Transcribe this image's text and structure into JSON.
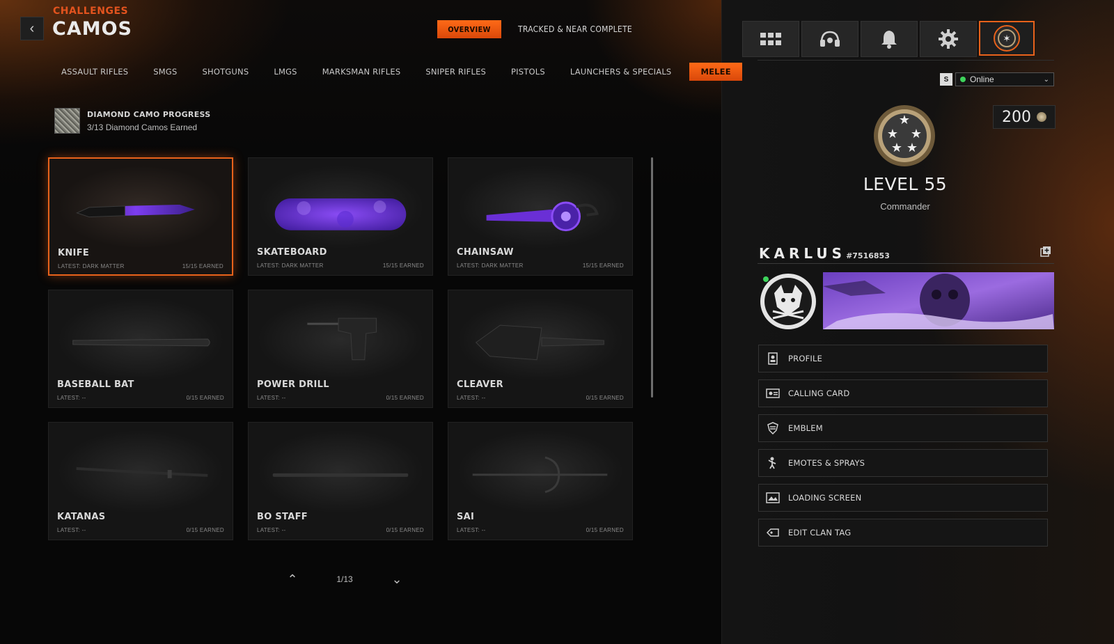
{
  "header": {
    "breadcrumb": "CHALLENGES",
    "title": "CAMOS",
    "tabs": [
      {
        "label": "OVERVIEW",
        "active": true
      },
      {
        "label": "TRACKED & NEAR COMPLETE",
        "active": false
      }
    ]
  },
  "categories": [
    {
      "label": "ASSAULT RIFLES"
    },
    {
      "label": "SMGS"
    },
    {
      "label": "SHOTGUNS"
    },
    {
      "label": "LMGS"
    },
    {
      "label": "MARKSMAN RIFLES"
    },
    {
      "label": "SNIPER RIFLES"
    },
    {
      "label": "PISTOLS"
    },
    {
      "label": "LAUNCHERS & SPECIALS"
    },
    {
      "label": "MELEE",
      "active": true
    }
  ],
  "diamond_progress": {
    "title": "DIAMOND CAMO PROGRESS",
    "subtitle": "3/13 Diamond Camos Earned"
  },
  "weapons": [
    {
      "name": "KNIFE",
      "latest": "LATEST: DARK MATTER",
      "earned": "15/15 EARNED"
    },
    {
      "name": "SKATEBOARD",
      "latest": "LATEST: DARK MATTER",
      "earned": "15/15 EARNED"
    },
    {
      "name": "CHAINSAW",
      "latest": "LATEST: DARK MATTER",
      "earned": "15/15 EARNED"
    },
    {
      "name": "BASEBALL BAT",
      "latest": "LATEST: --",
      "earned": "0/15 EARNED"
    },
    {
      "name": "POWER DRILL",
      "latest": "LATEST: --",
      "earned": "0/15 EARNED"
    },
    {
      "name": "CLEAVER",
      "latest": "LATEST: --",
      "earned": "0/15 EARNED"
    },
    {
      "name": "KATANAS",
      "latest": "LATEST: --",
      "earned": "0/15 EARNED"
    },
    {
      "name": "BO STAFF",
      "latest": "LATEST: --",
      "earned": "0/15 EARNED"
    },
    {
      "name": "SAI",
      "latest": "LATEST: --",
      "earned": "0/15 EARNED"
    }
  ],
  "pager": {
    "label": "1/13"
  },
  "top_icons": [
    "grid-menu-icon",
    "social-headset-icon",
    "notifications-bell-icon",
    "settings-gear-icon",
    "profile-rank-icon"
  ],
  "status": {
    "badge": "S",
    "value": "Online"
  },
  "currency": {
    "value": "200"
  },
  "rank": {
    "level": "LEVEL 55",
    "title": "Commander"
  },
  "player": {
    "name": "KARLUS",
    "tag": "#7516853"
  },
  "menu": [
    {
      "label": "PROFILE",
      "icon": "profile-icon"
    },
    {
      "label": "CALLING CARD",
      "icon": "calling-card-icon"
    },
    {
      "label": "EMBLEM",
      "icon": "emblem-icon"
    },
    {
      "label": "EMOTES & SPRAYS",
      "icon": "emotes-icon"
    },
    {
      "label": "LOADING SCREEN",
      "icon": "loading-screen-icon"
    },
    {
      "label": "EDIT CLAN TAG",
      "icon": "clan-tag-icon"
    }
  ],
  "colors": {
    "accent": "#e8621b",
    "online": "#3dd35b",
    "dark_matter": "#6a2fd6"
  }
}
